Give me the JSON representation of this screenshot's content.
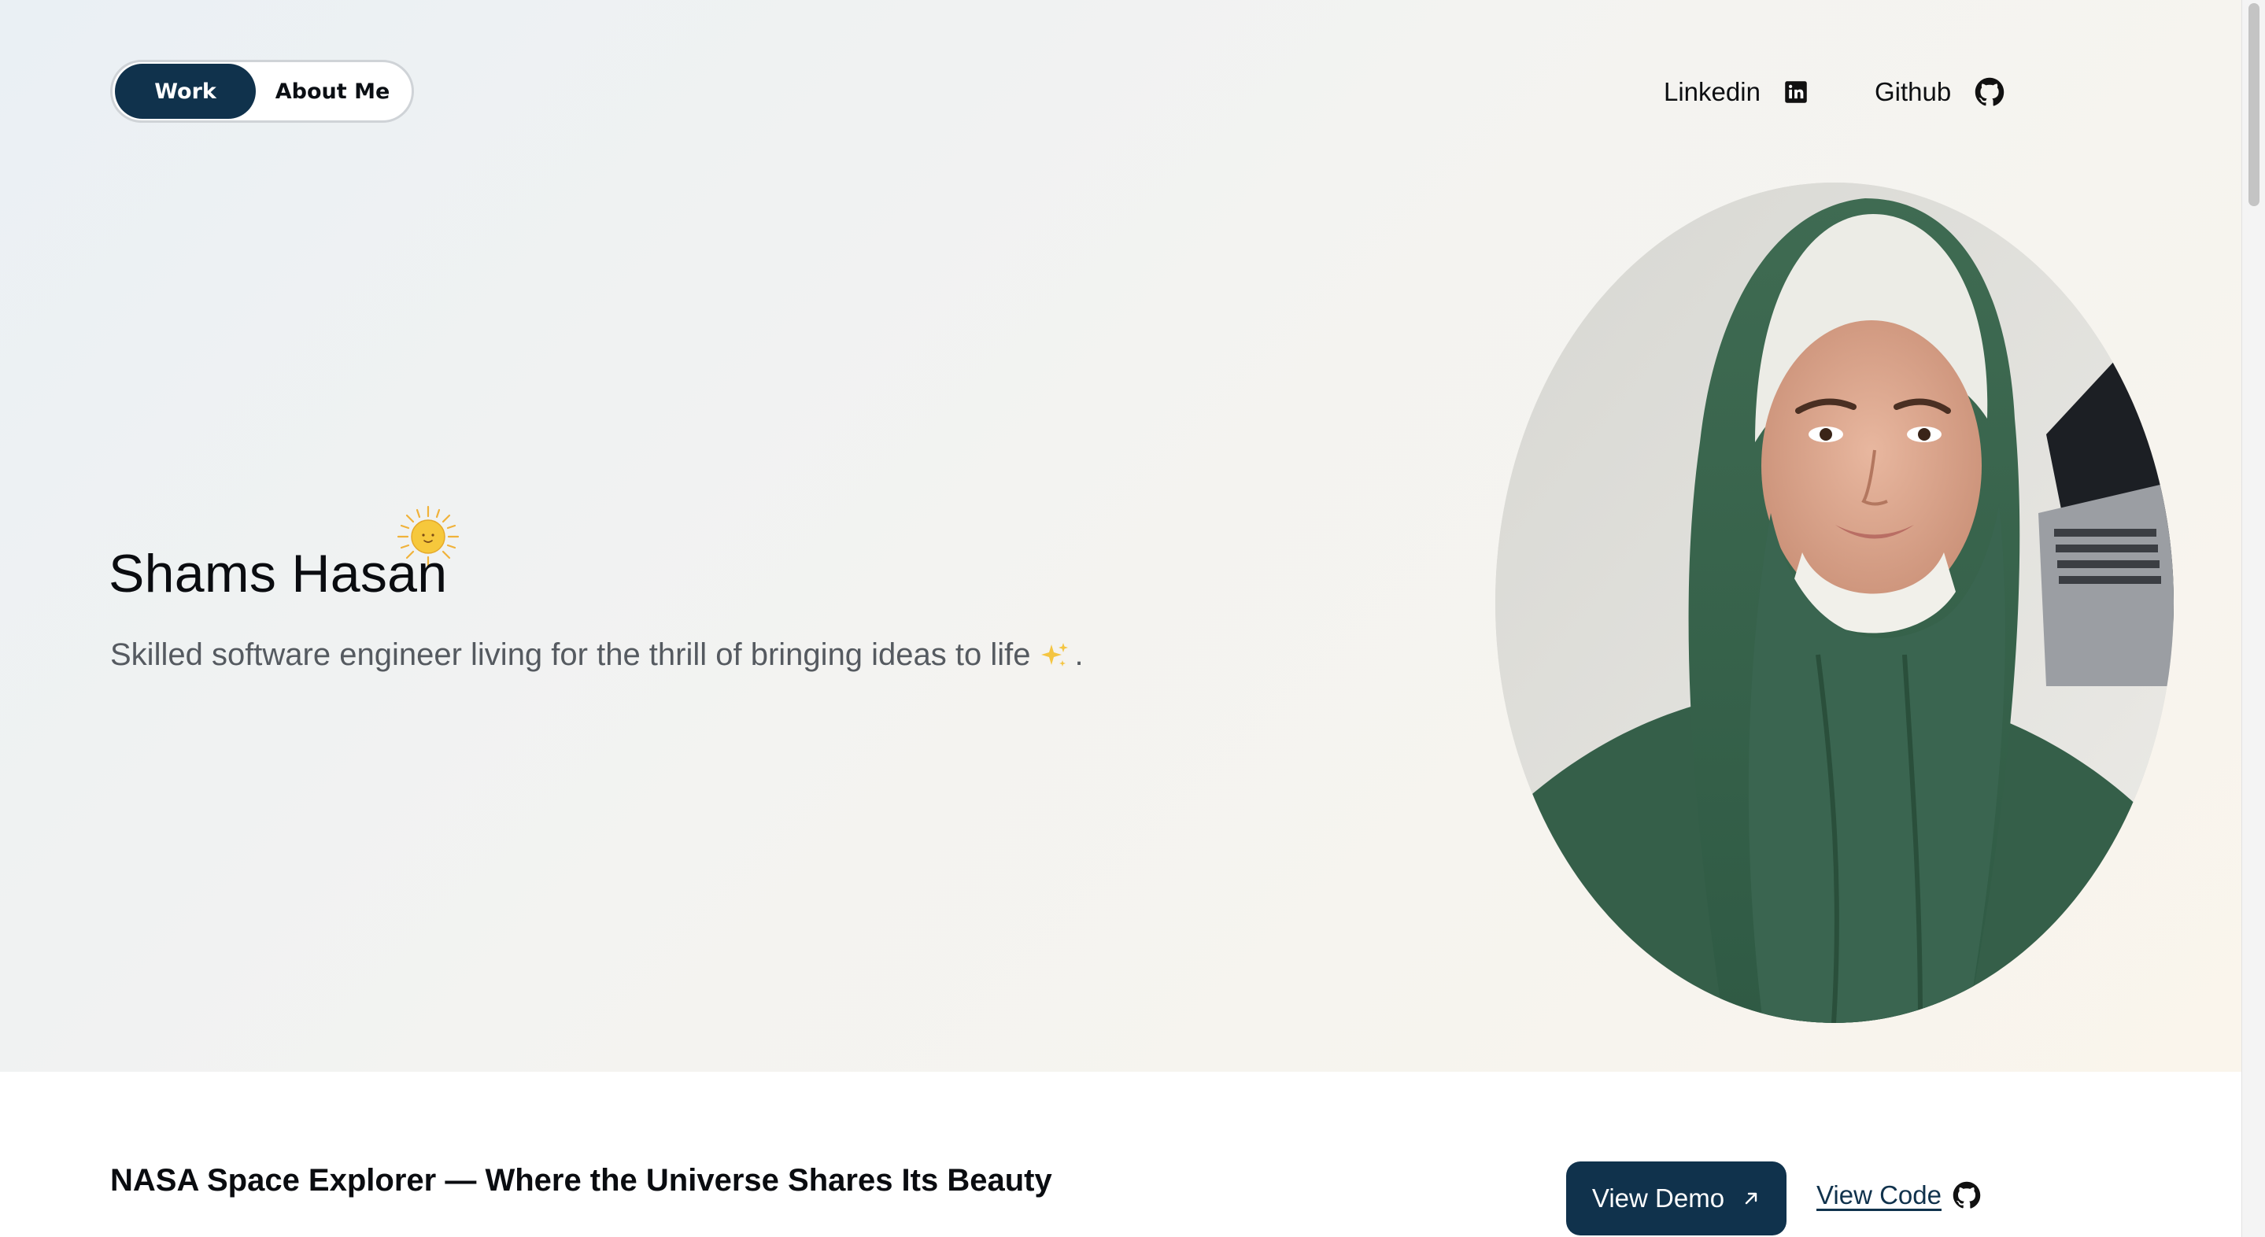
{
  "toggle": {
    "work_label": "Work",
    "about_label": "About Me",
    "active": "Work"
  },
  "nav": {
    "linkedin_label": "Linkedin",
    "github_label": "Github"
  },
  "hero": {
    "name": "Shams Hasan",
    "tagline": "Skilled software engineer living for the thrill of bringing ideas to life",
    "tagline_end": "."
  },
  "project": {
    "title": "NASA Space Explorer — Where the Universe Shares Its Beauty",
    "demo_label": "View Demo",
    "code_label": "View Code"
  },
  "colors": {
    "primary": "#10324c",
    "text": "#0a0c10",
    "muted": "#555a60",
    "hijab": "#3f6b52",
    "sun": "#f2c33a"
  },
  "icons": {
    "linkedin": "linkedin-icon",
    "github": "github-icon",
    "sun": "sun-icon",
    "sparkle": "sparkles-icon",
    "arrow": "arrow-up-right-icon"
  }
}
